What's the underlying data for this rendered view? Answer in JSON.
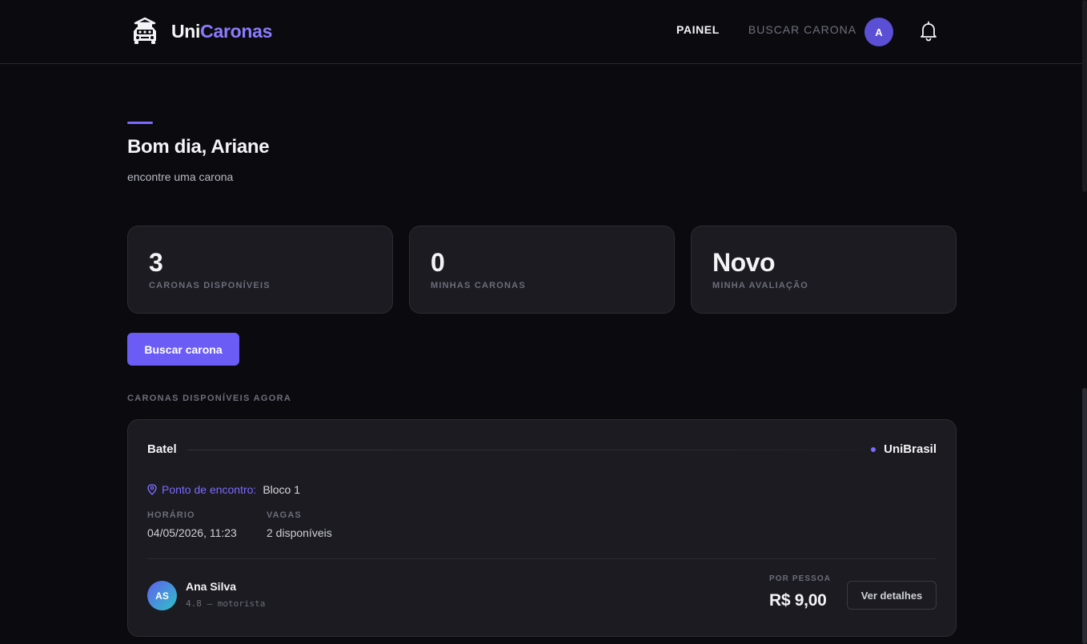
{
  "header": {
    "brand_part1": "Uni",
    "brand_part2": "Caronas",
    "logo_icon": "car-logo-icon",
    "nav": [
      {
        "label": "PAINEL",
        "active": true
      },
      {
        "label": "BUSCAR CARONA",
        "active": false
      }
    ],
    "avatar_initial": "A",
    "bell_icon": "bell-icon"
  },
  "hero": {
    "greeting": "Bom dia, Ariane",
    "subtitle": "encontre uma carona"
  },
  "stats": [
    {
      "value": "3",
      "label": "CARONAS DISPONÍVEIS"
    },
    {
      "value": "0",
      "label": "MINHAS CARONAS"
    },
    {
      "value": "Novo",
      "label": "MINHA AVALIAÇÃO"
    }
  ],
  "actions": {
    "search_button": "Buscar carona"
  },
  "section": {
    "title": "CARONAS DISPONÍVEIS AGORA"
  },
  "ride": {
    "from": "Batel",
    "to": "UniBrasil",
    "meeting_label": "Ponto de encontro:",
    "meeting_value": "Bloco 1",
    "time_label": "HORÁRIO",
    "time_value": "04/05/2026, 11:23",
    "seats_label": "VAGAS",
    "seats_value": "2 disponíveis",
    "driver_initials": "AS",
    "driver_name": "Ana Silva",
    "driver_meta": "4.8 — motorista",
    "price_label": "POR PESSOA",
    "price": "R$ 9,00",
    "details_button": "Ver detalhes"
  },
  "colors": {
    "accent": "#6c5cf6",
    "background": "#0b0b0f",
    "card": "#1b1b21"
  }
}
